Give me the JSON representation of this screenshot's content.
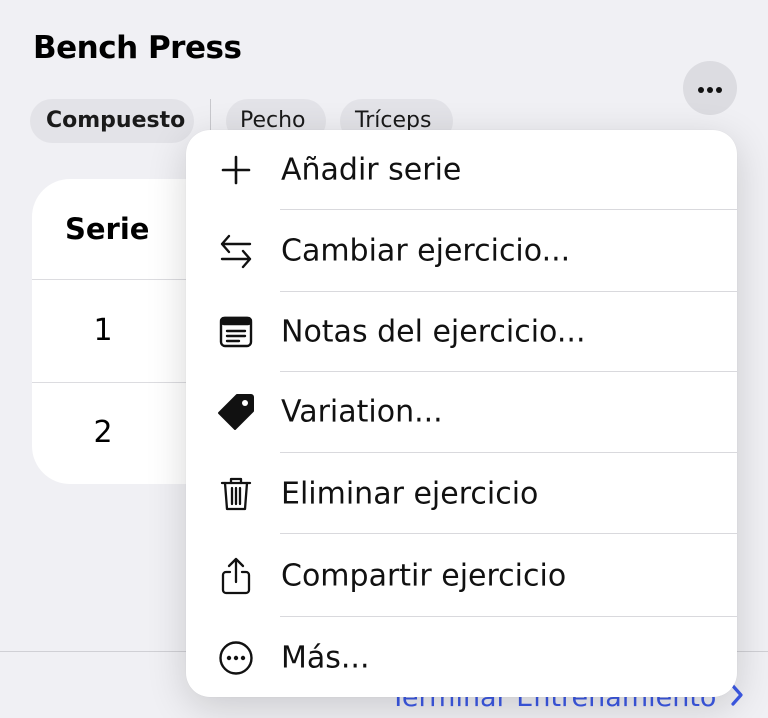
{
  "exercise": {
    "title": "Bench Press",
    "tags": [
      "Compuesto",
      "Pecho",
      "Tríceps"
    ]
  },
  "more_button": {
    "icon": "ellipsis-icon"
  },
  "table": {
    "header": "Serie",
    "rows": [
      "1",
      "2"
    ]
  },
  "footer": {
    "finish_label": "Terminar Entrenamiento",
    "finish_color": "#3c59e6"
  },
  "menu": {
    "items": [
      {
        "icon": "plus-icon",
        "label": "Añadir serie"
      },
      {
        "icon": "swap-arrows-icon",
        "label": "Cambiar ejercicio..."
      },
      {
        "icon": "notes-icon",
        "label": "Notas del ejercicio..."
      },
      {
        "icon": "tag-icon",
        "label": "Variation..."
      },
      {
        "icon": "trash-icon",
        "label": "Eliminar ejercicio"
      },
      {
        "icon": "share-icon",
        "label": "Compartir ejercicio"
      },
      {
        "icon": "ellipsis-circle-icon",
        "label": "Más..."
      }
    ]
  }
}
